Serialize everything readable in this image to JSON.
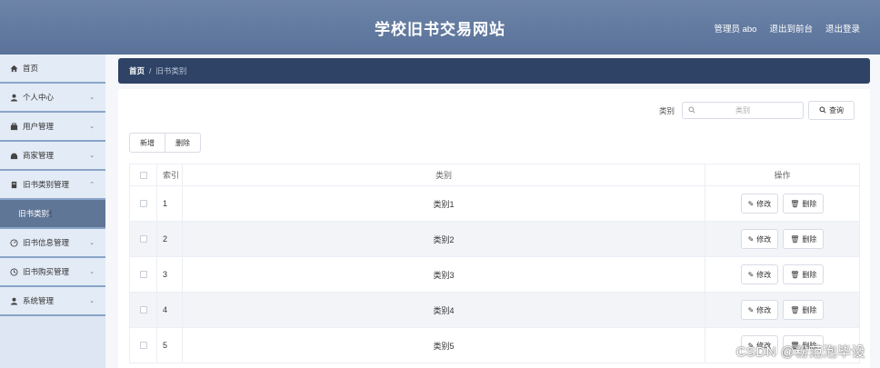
{
  "header": {
    "title": "学校旧书交易网站",
    "admin": "管理员 abo",
    "to_front": "退出到前台",
    "logout": "退出登录"
  },
  "sidebar": {
    "items": [
      {
        "label": "首页",
        "icon": "home-icon"
      },
      {
        "label": "个人中心",
        "icon": "user-icon"
      },
      {
        "label": "用户管理",
        "icon": "users-icon"
      },
      {
        "label": "商家管理",
        "icon": "shop-icon"
      },
      {
        "label": "旧书类别管理",
        "icon": "category-icon"
      },
      {
        "label": "旧书类别",
        "icon": ""
      },
      {
        "label": "旧书信息管理",
        "icon": "gauge-icon"
      },
      {
        "label": "旧书购买管理",
        "icon": "clock-icon"
      },
      {
        "label": "系统管理",
        "icon": "system-icon"
      }
    ]
  },
  "breadcrumb": {
    "home": "首页",
    "sep": "/",
    "current": "旧书类别"
  },
  "search": {
    "label": "类别",
    "placeholder": "类别",
    "button": "查询"
  },
  "actions": {
    "add": "新增",
    "delete": "删除"
  },
  "table": {
    "headers": {
      "index": "索引",
      "category": "类别",
      "ops": "操作"
    },
    "rows": [
      {
        "index": "1",
        "category": "类别1"
      },
      {
        "index": "2",
        "category": "类别2"
      },
      {
        "index": "3",
        "category": "类别3"
      },
      {
        "index": "4",
        "category": "类别4"
      },
      {
        "index": "5",
        "category": "类别5"
      }
    ],
    "edit_label": "修改",
    "delete_label": "删除"
  },
  "watermark": "CSDN @粉范泡毕设",
  "colors": {
    "header": "#5f7799",
    "breadcrumb": "#2e4366",
    "sidebar_active": "#5f7697",
    "sidebar_bg": "#e3ebf6"
  }
}
